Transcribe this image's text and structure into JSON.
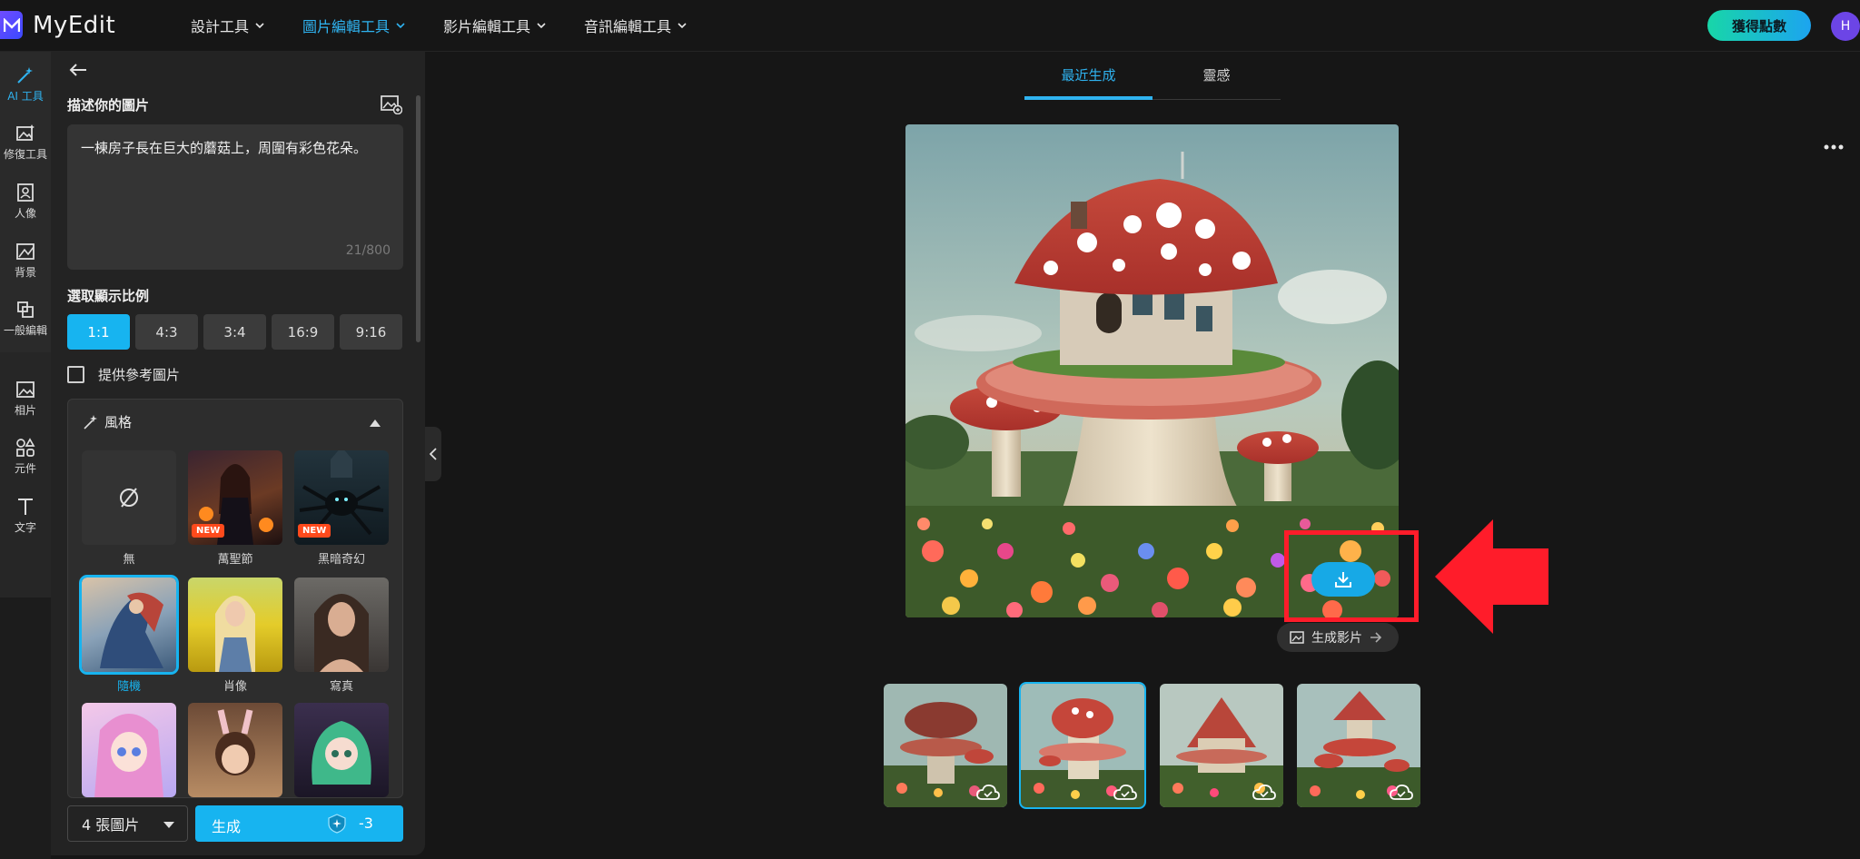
{
  "app": {
    "name": "MyEdit",
    "avatar_initial": "H",
    "get_points_label": "獲得點數"
  },
  "nav": [
    {
      "label": "設計工具",
      "active": false
    },
    {
      "label": "圖片編輯工具",
      "active": true
    },
    {
      "label": "影片編輯工具",
      "active": false
    },
    {
      "label": "音訊編輯工具",
      "active": false
    }
  ],
  "rail": [
    {
      "label": "AI 工具",
      "icon": "magic-wand-icon",
      "active": true
    },
    {
      "label": "修復工具",
      "icon": "image-fix-icon",
      "active": false
    },
    {
      "label": "人像",
      "icon": "portrait-icon",
      "active": false
    },
    {
      "label": "背景",
      "icon": "background-icon",
      "active": false
    },
    {
      "label": "一般編輯",
      "icon": "crop-icon",
      "active": false
    },
    {
      "label": "相片",
      "icon": "photo-icon",
      "active": false
    },
    {
      "label": "元件",
      "icon": "shapes-icon",
      "active": false
    },
    {
      "label": "文字",
      "icon": "text-icon",
      "active": false
    }
  ],
  "panel": {
    "describe_title": "描述你的圖片",
    "prompt_text": "一棟房子長在巨大的蘑菇上，周圍有彩色花朵。",
    "char_count": "21/800",
    "ratio_title": "選取顯示比例",
    "ratios": [
      "1:1",
      "4:3",
      "3:4",
      "16:9",
      "9:16"
    ],
    "ratio_selected": "1:1",
    "reference_label": "提供參考圖片",
    "reference_checked": false,
    "style_title": "風格",
    "new_badge": "NEW",
    "styles": [
      {
        "label": "無",
        "new": false
      },
      {
        "label": "萬聖節",
        "new": true
      },
      {
        "label": "黑暗奇幻",
        "new": true
      },
      {
        "label": "隨機",
        "new": false,
        "selected": true
      },
      {
        "label": "肖像",
        "new": false
      },
      {
        "label": "寫真",
        "new": false
      },
      {
        "label": "",
        "new": false
      },
      {
        "label": "",
        "new": false
      },
      {
        "label": "",
        "new": false
      }
    ],
    "image_count": "4 張圖片",
    "generate_label": "生成",
    "credit_cost": "-3"
  },
  "main": {
    "tabs": [
      {
        "label": "最近生成",
        "active": true
      },
      {
        "label": "靈感",
        "active": false
      }
    ],
    "generate_video_label": "生成影片",
    "thumbnails_count": 4,
    "selected_thumbnail": 2
  },
  "colors": {
    "accent": "#17b4f0",
    "highlight": "#ff1c2a",
    "brand": "#5b4cff"
  }
}
